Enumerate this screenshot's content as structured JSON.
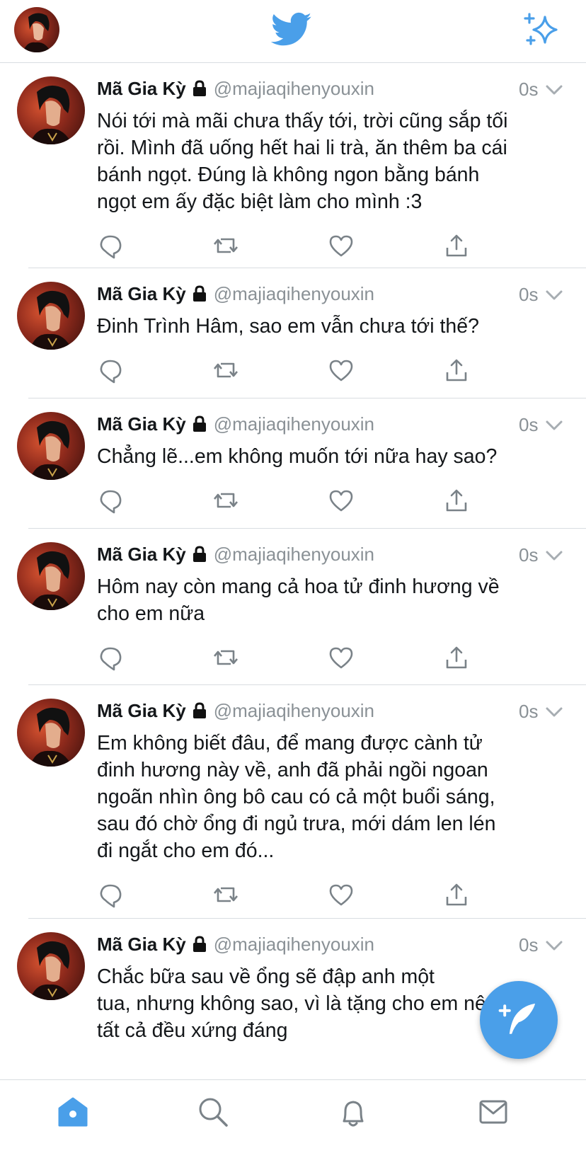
{
  "colors": {
    "accent": "#4a9fe9",
    "muted": "#8a9196",
    "text": "#14171a",
    "divider": "#d9dde1"
  },
  "topbar": {
    "icons": [
      "profile-avatar",
      "twitter-bird-icon",
      "sparkle-icon"
    ]
  },
  "tweets": [
    {
      "name": "Mã Gia Kỳ",
      "handle": "@majiaqihenyouxin",
      "time": "0s",
      "lines": [
        "Nói tới mà mãi chưa thấy tới, trời cũng sắp tối",
        "rồi. Mình đã uống hết hai li trà, ăn thêm ba cái",
        "bánh ngọt. Đúng là không ngon bằng bánh",
        "ngọt em ấy đặc biệt làm cho mình :3"
      ]
    },
    {
      "name": "Mã Gia Kỳ",
      "handle": "@majiaqihenyouxin",
      "time": "0s",
      "lines": [
        "Đinh Trình Hâm, sao em vẫn chưa tới thế?"
      ]
    },
    {
      "name": "Mã Gia Kỳ",
      "handle": "@majiaqihenyouxin",
      "time": "0s",
      "lines": [
        "Chẳng lẽ...em không muốn tới nữa hay sao?"
      ]
    },
    {
      "name": "Mã Gia Kỳ",
      "handle": "@majiaqihenyouxin",
      "time": "0s",
      "lines": [
        "Hôm nay còn mang cả hoa tử đinh hương về",
        "cho em nữa"
      ]
    },
    {
      "name": "Mã Gia Kỳ",
      "handle": "@majiaqihenyouxin",
      "time": "0s",
      "lines": [
        "Em không biết đâu, để mang được cành tử",
        "đinh hương này về, anh đã phải ngồi ngoan",
        "ngoãn nhìn ông bô cau có cả một buổi sáng,",
        "sau đó chờ ổng đi ngủ trưa, mới dám len lén",
        "đi ngắt cho em đó..."
      ]
    },
    {
      "name": "Mã Gia Kỳ",
      "handle": "@majiaqihenyouxin",
      "time": "0s",
      "lines": [
        "Chắc bữa sau về ổng sẽ đập anh một",
        "tua, nhưng không sao, vì là tặng cho em nên",
        "tất cả đều xứng đáng"
      ]
    }
  ],
  "actions": [
    "reply-icon",
    "retweet-icon",
    "like-icon",
    "share-icon"
  ],
  "compose_button": {
    "icon": "compose-feather-icon"
  },
  "tabbar": {
    "tabs": [
      "home-icon",
      "search-icon",
      "notifications-icon",
      "messages-icon"
    ],
    "active": "home-icon"
  }
}
